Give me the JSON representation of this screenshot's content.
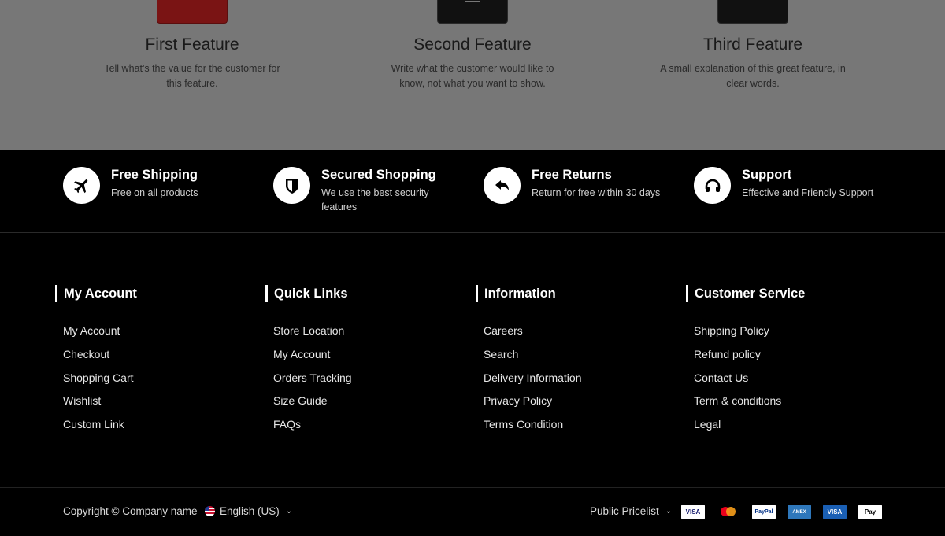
{
  "features": [
    {
      "title": "First Feature",
      "desc": "Tell what's the value for the customer for this feature.",
      "tile": "red"
    },
    {
      "title": "Second Feature",
      "desc": "Write what the customer would like to know, not what you want to show.",
      "tile": "black"
    },
    {
      "title": "Third Feature",
      "desc": "A small explanation of this great feature, in clear words.",
      "tile": "black"
    }
  ],
  "services": [
    {
      "title": "Free Shipping",
      "desc": "Free on all products",
      "icon": "airplane-icon"
    },
    {
      "title": "Secured Shopping",
      "desc": "We use the best security features",
      "icon": "shield-icon"
    },
    {
      "title": "Free Returns",
      "desc": "Return for free within 30 days",
      "icon": "return-arrow-icon"
    },
    {
      "title": "Support",
      "desc": "Effective and Friendly Support",
      "icon": "headset-icon"
    }
  ],
  "columns": [
    {
      "title": "My Account",
      "links": [
        "My Account",
        "Checkout",
        "Shopping Cart",
        "Wishlist",
        "Custom Link"
      ]
    },
    {
      "title": "Quick Links",
      "links": [
        "Store Location",
        "My Account",
        "Orders Tracking",
        "Size Guide",
        "FAQs"
      ]
    },
    {
      "title": "Information",
      "links": [
        "Careers",
        "Search",
        "Delivery Information",
        "Privacy Policy",
        "Terms Condition"
      ]
    },
    {
      "title": "Customer Service",
      "links": [
        "Shipping Policy",
        "Refund policy",
        "Contact Us",
        "Term & conditions",
        "Legal"
      ]
    }
  ],
  "bottom": {
    "copyright": "Copyright © Company name",
    "language": "English (US)",
    "pricelist": "Public Pricelist",
    "payments": [
      "VISA",
      "",
      "PayPal",
      "AMEX",
      "VISA",
      " Pay"
    ]
  },
  "colors": {
    "background": "#000000",
    "dimmed_section": "#777777",
    "text": "#ffffff"
  }
}
